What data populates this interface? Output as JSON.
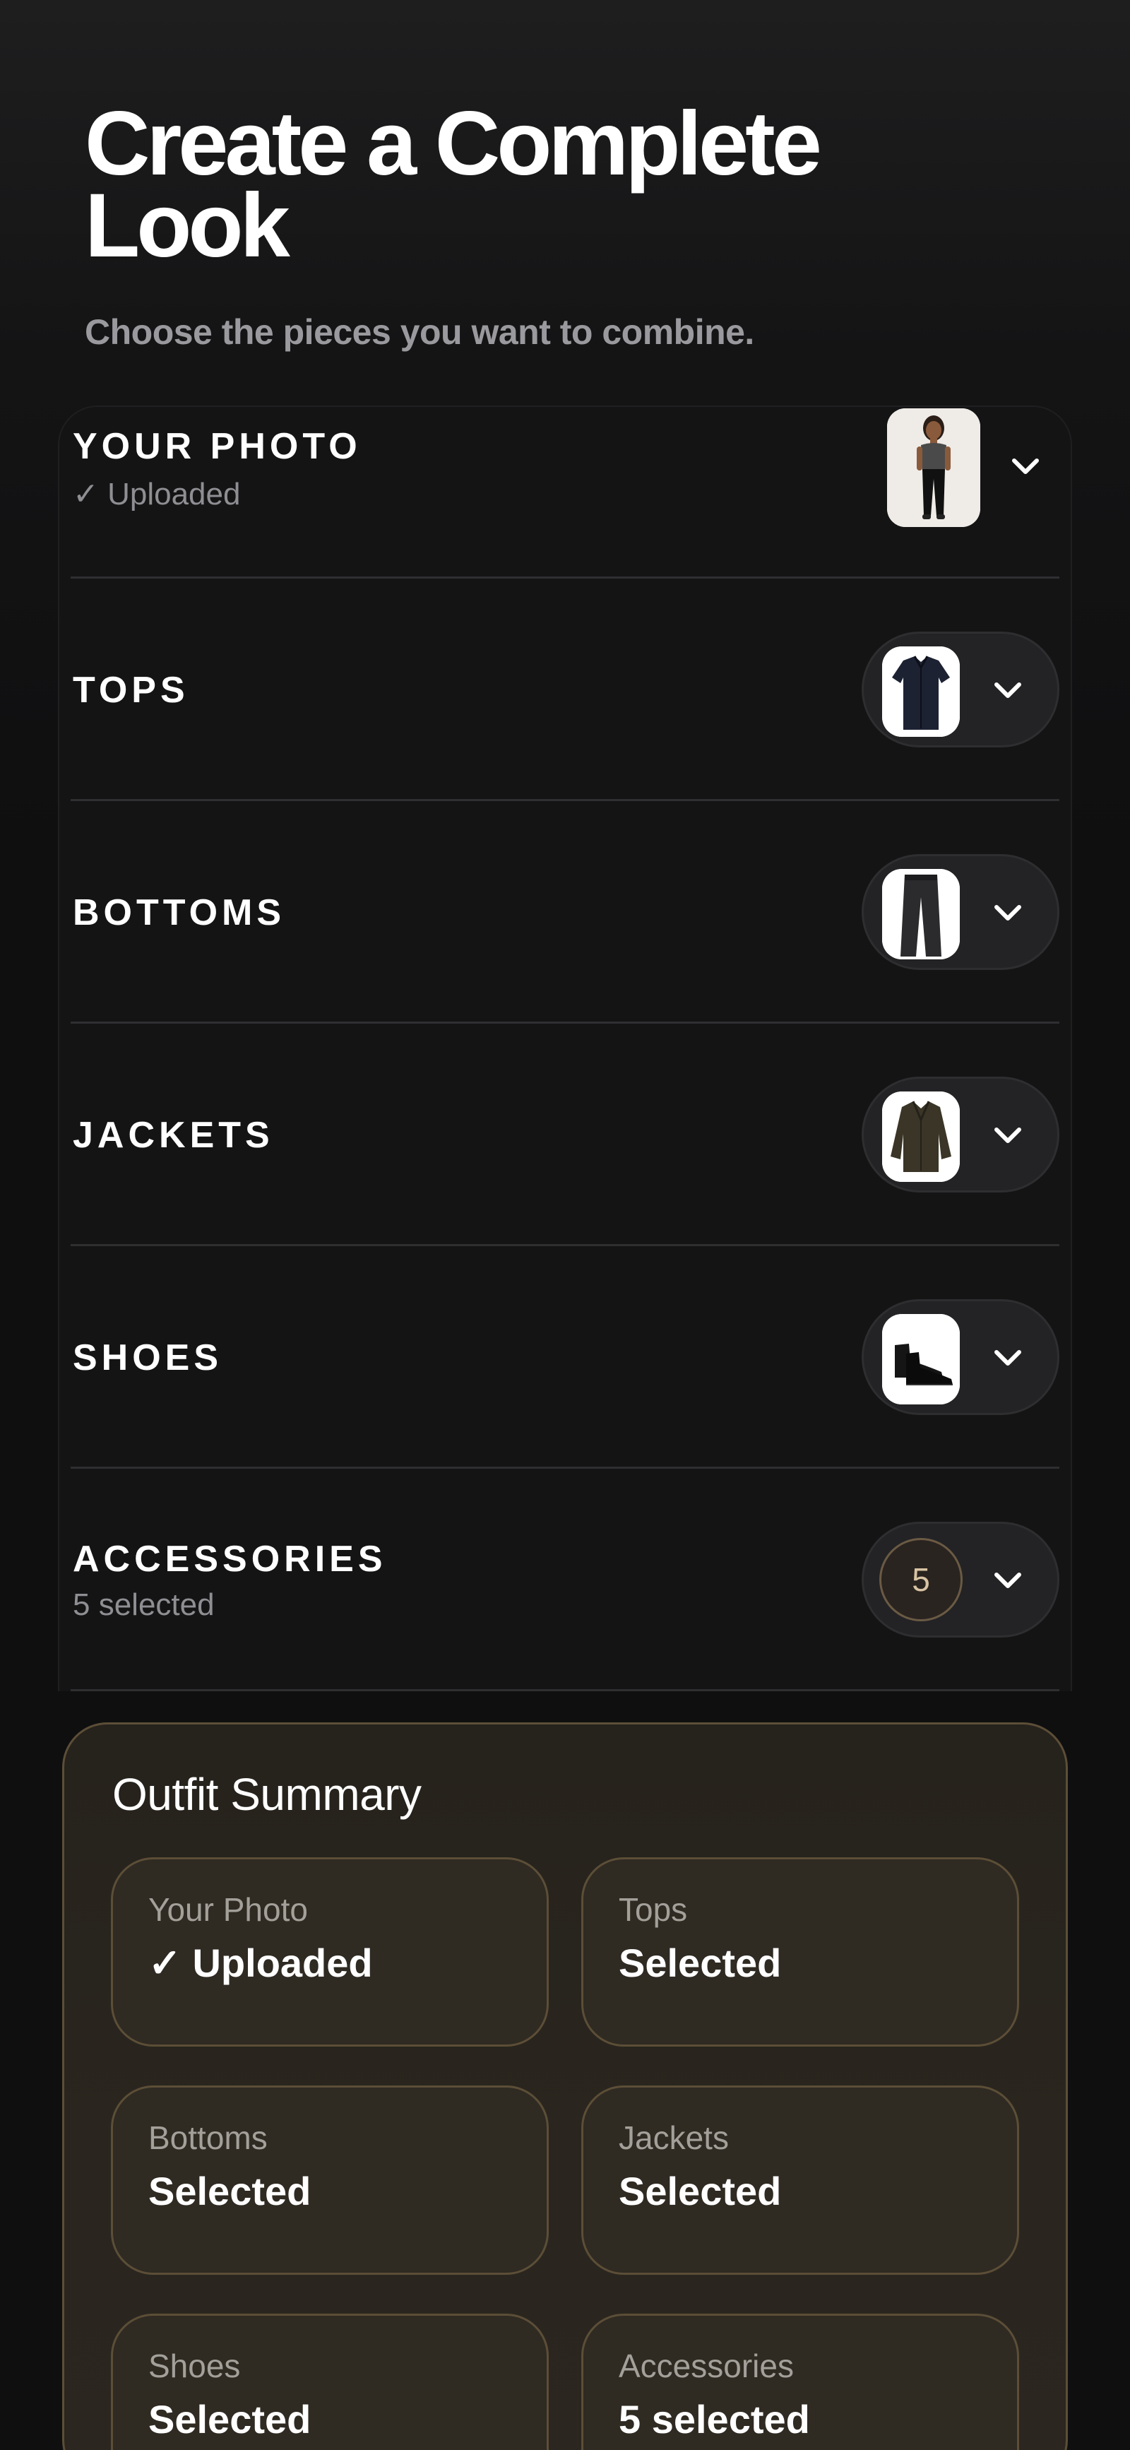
{
  "header": {
    "title": "Create a Complete Look",
    "subtitle": "Choose the pieces you want to combine."
  },
  "sections": [
    {
      "label": "YOUR PHOTO",
      "status": "✓ Uploaded"
    },
    {
      "label": "TOPS"
    },
    {
      "label": "BOTTOMS"
    },
    {
      "label": "JACKETS"
    },
    {
      "label": "SHOES"
    },
    {
      "label": "ACCESSORIES",
      "status": "5 selected",
      "count": "5"
    }
  ],
  "summary": {
    "title": "Outfit Summary",
    "items": [
      {
        "label": "Your Photo",
        "value": "✓ Uploaded"
      },
      {
        "label": "Tops",
        "value": "Selected"
      },
      {
        "label": "Bottoms",
        "value": "Selected"
      },
      {
        "label": "Jackets",
        "value": "Selected"
      },
      {
        "label": "Shoes",
        "value": "Selected"
      },
      {
        "label": "Accessories",
        "value": "5 selected"
      }
    ]
  },
  "icons": {
    "expand": "chevron-down-icon"
  },
  "colors": {
    "background": "#111112",
    "accent_border": "#5c4e37",
    "badge_text": "#d8c3a3",
    "muted_text": "#8e8e93"
  }
}
